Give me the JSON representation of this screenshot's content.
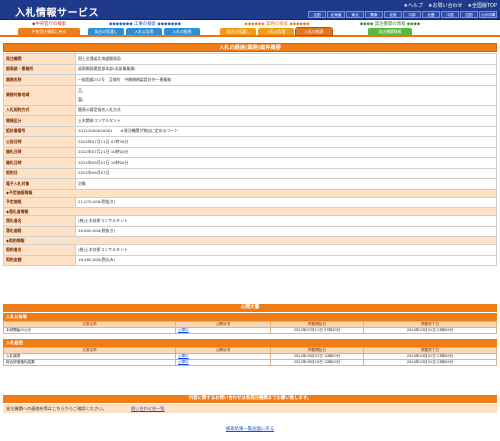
{
  "header": {
    "logo": "入札情報サービス",
    "links": [
      "★ヘルプ",
      "★お問い合わせ",
      "★全国版TOP"
    ],
    "regions": [
      "全国",
      "北海道",
      "東北",
      "関東",
      "北陸",
      "中部",
      "近畿",
      "中国",
      "四国",
      "九州沖縄"
    ]
  },
  "nav": {
    "groups": [
      {
        "title": "◆中央官庁の検索",
        "tabs": [
          "中央官庁検索に戻る"
        ]
      },
      {
        "title": "◆◆◆◆◆◆◆ 工事の検索 ◆◆◆◆◆◆◆",
        "tabs": [
          "発注の見通し",
          "入札公告等",
          "入札の経過"
        ]
      },
      {
        "title": "◆◆◆◆◆◆ 業務の検索 ◆◆◆◆◆◆",
        "tabs": [
          "発注の見通し",
          "入札公告等",
          "入札の経過"
        ]
      },
      {
        "title": "◆◆◆◆ 発注機関の情報 ◆◆◆◆",
        "tabs": [
          "発注機関情報"
        ]
      }
    ]
  },
  "page_title": "入札の経過(業務)案件概要",
  "rows": [
    {
      "label": "発注機関",
      "value": "国土交通省北海道開発局"
    },
    {
      "label": "部局部・事務所",
      "value": "留萌開発建設部本部(本部事業課)"
    },
    {
      "label": "業務名称",
      "value": "一般国道232号　苫前町　中開橋橋梁設計外一連業務"
    },
    {
      "label": "業務対象地域",
      "value": "苫、\n富)"
    },
    {
      "label": "入札契約方式",
      "value": "簡易公募型指名入札方式"
    },
    {
      "label": "業務区分",
      "value": "土木関係コンサルタント"
    },
    {
      "label": "設計書番号",
      "value": "20123000020001　　※発注機関が独自に定めるコード"
    },
    {
      "label": "公告日時",
      "value": "2022年07月11日 07時30分"
    },
    {
      "label": "開札日時",
      "value": "2022年07月21日 10時00分"
    },
    {
      "label": "開札日時",
      "value": "2022年09月07日 10時00分"
    },
    {
      "label": "契約日",
      "value": "2022年09月07日"
    },
    {
      "label": "電子入札対象",
      "value": "対象"
    }
  ],
  "sections": {
    "estimate": {
      "title": "◆予定価格情報",
      "label": "予定価格",
      "value": "21,070,000(税抜き)"
    },
    "winner": {
      "title": "◆落札者情報",
      "label_name": "落札者名",
      "name": "(株)土木技術コンサルタント",
      "label_amount": "落札価格",
      "amount": "16,800,000(税抜き)"
    },
    "contract": {
      "title": "◆契約情報",
      "label_name": "契約者名",
      "name": "(株)土木技術コンサルタント",
      "label_amount": "契約金額",
      "amount": "18,480,000(税込み)"
    }
  },
  "public_docs": {
    "title": "公開文書",
    "koukoku": {
      "sub": "入札公告等",
      "headers": [
        "文書名称",
        "公開状況",
        "掲載開始日",
        "掲載終了日"
      ],
      "rows": [
        [
          "手続開始の公示",
          "公開中",
          "2022年07月11日 07時30分",
          "2024年03月31日 23時59分"
        ]
      ]
    },
    "keika": {
      "sub": "入札経過",
      "headers": [
        "文書名称",
        "公開状況",
        "掲載開始日",
        "掲載終了日"
      ],
      "rows": [
        [
          "入札調書",
          "公開中",
          "2022年09月07日 10時00分",
          "2024年03月31日 23時59分"
        ],
        [
          "総合評価落札結果",
          "公開中",
          "2022年09月16日 10時00分",
          "2024年03月31日 23時59分"
        ]
      ]
    }
  },
  "info": {
    "bar": "内容に関するお問い合わせは各発注機関までお願い致します。",
    "left": "発注機関への連絡先等はこちらからご確認ください。",
    "right": "問い合わせ先一覧"
  },
  "back_link": "検索結果一覧画面に戻る",
  "colors": {
    "navy": "#1f3a8a",
    "orange": "#f07c16",
    "peach": "#fde2c8",
    "link": "#1a4fd8"
  }
}
